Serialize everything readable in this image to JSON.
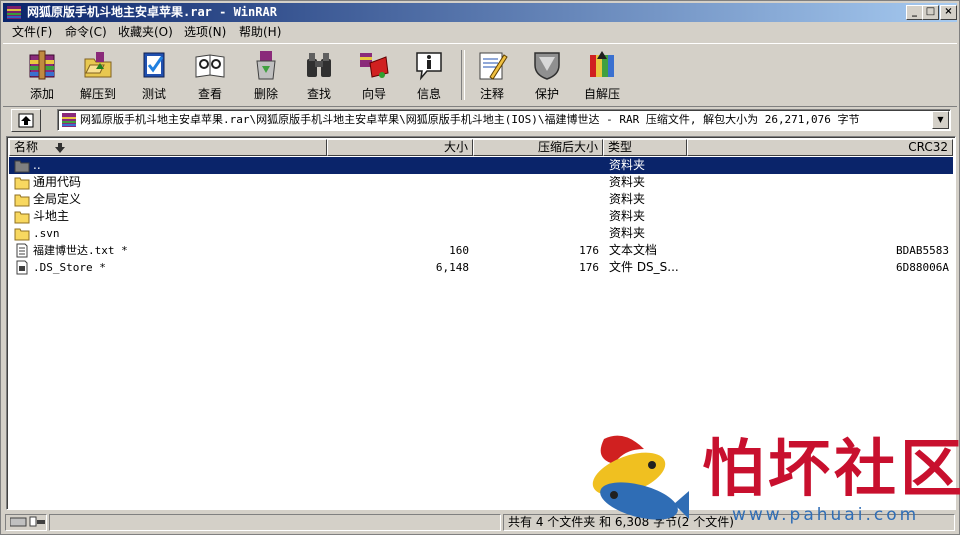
{
  "window": {
    "title": "网狐原版手机斗地主安卓苹果.rar - WinRAR",
    "min_icon": "minimize-icon",
    "max_icon": "maximize-icon",
    "close_icon": "close-icon",
    "min_glyph": "_",
    "max_glyph": "□",
    "close_glyph": "×"
  },
  "menu": {
    "items": [
      {
        "label": "文件(F)"
      },
      {
        "label": "命令(C)"
      },
      {
        "label": "收藏夹(O)"
      },
      {
        "label": "选项(N)"
      },
      {
        "label": "帮助(H)"
      }
    ]
  },
  "toolbar": {
    "buttons": [
      {
        "label": "添加",
        "icon": "add-archive-icon"
      },
      {
        "label": "解压到",
        "icon": "extract-to-icon"
      },
      {
        "label": "测试",
        "icon": "test-icon"
      },
      {
        "label": "查看",
        "icon": "view-icon"
      },
      {
        "label": "删除",
        "icon": "delete-icon"
      },
      {
        "label": "查找",
        "icon": "find-icon"
      },
      {
        "label": "向导",
        "icon": "wizard-icon"
      },
      {
        "label": "信息",
        "icon": "info-icon"
      },
      {
        "label": "注释",
        "icon": "comment-icon"
      },
      {
        "label": "保护",
        "icon": "protect-icon"
      },
      {
        "label": "自解压",
        "icon": "sfx-icon"
      }
    ]
  },
  "address": {
    "path": "网狐原版手机斗地主安卓苹果.rar\\网狐原版手机斗地主安卓苹果\\网狐原版手机斗地主(IOS)\\福建博世达 - RAR 压缩文件, 解包大小为 26,271,076 字节"
  },
  "columns": {
    "name": "名称",
    "size": "大小",
    "packed": "压缩后大小",
    "type": "类型",
    "crc": "CRC32"
  },
  "files": [
    {
      "name": "..",
      "size": "",
      "packed": "",
      "type": "资料夹",
      "crc": "",
      "icon": "folder-up-icon",
      "selected": true
    },
    {
      "name": "通用代码",
      "size": "",
      "packed": "",
      "type": "资料夹",
      "crc": "",
      "icon": "folder-icon"
    },
    {
      "name": "全局定义",
      "size": "",
      "packed": "",
      "type": "资料夹",
      "crc": "",
      "icon": "folder-icon"
    },
    {
      "name": "斗地主",
      "size": "",
      "packed": "",
      "type": "资料夹",
      "crc": "",
      "icon": "folder-icon"
    },
    {
      "name": ".svn",
      "size": "",
      "packed": "",
      "type": "资料夹",
      "crc": "",
      "icon": "folder-icon"
    },
    {
      "name": "福建博世达.txt *",
      "size": "160",
      "packed": "176",
      "type": "文本文档",
      "crc": "BDAB5583",
      "icon": "text-file-icon"
    },
    {
      "name": ".DS_Store *",
      "size": "6,148",
      "packed": "176",
      "type": "文件 DS_S...",
      "crc": "6D88006A",
      "icon": "file-icon"
    }
  ],
  "status": {
    "summary": "共有 4 个文件夹 和 6,308 字节(2 个文件)"
  },
  "watermark": {
    "text": "怕坏社区",
    "url": "www.pahuai.com"
  }
}
